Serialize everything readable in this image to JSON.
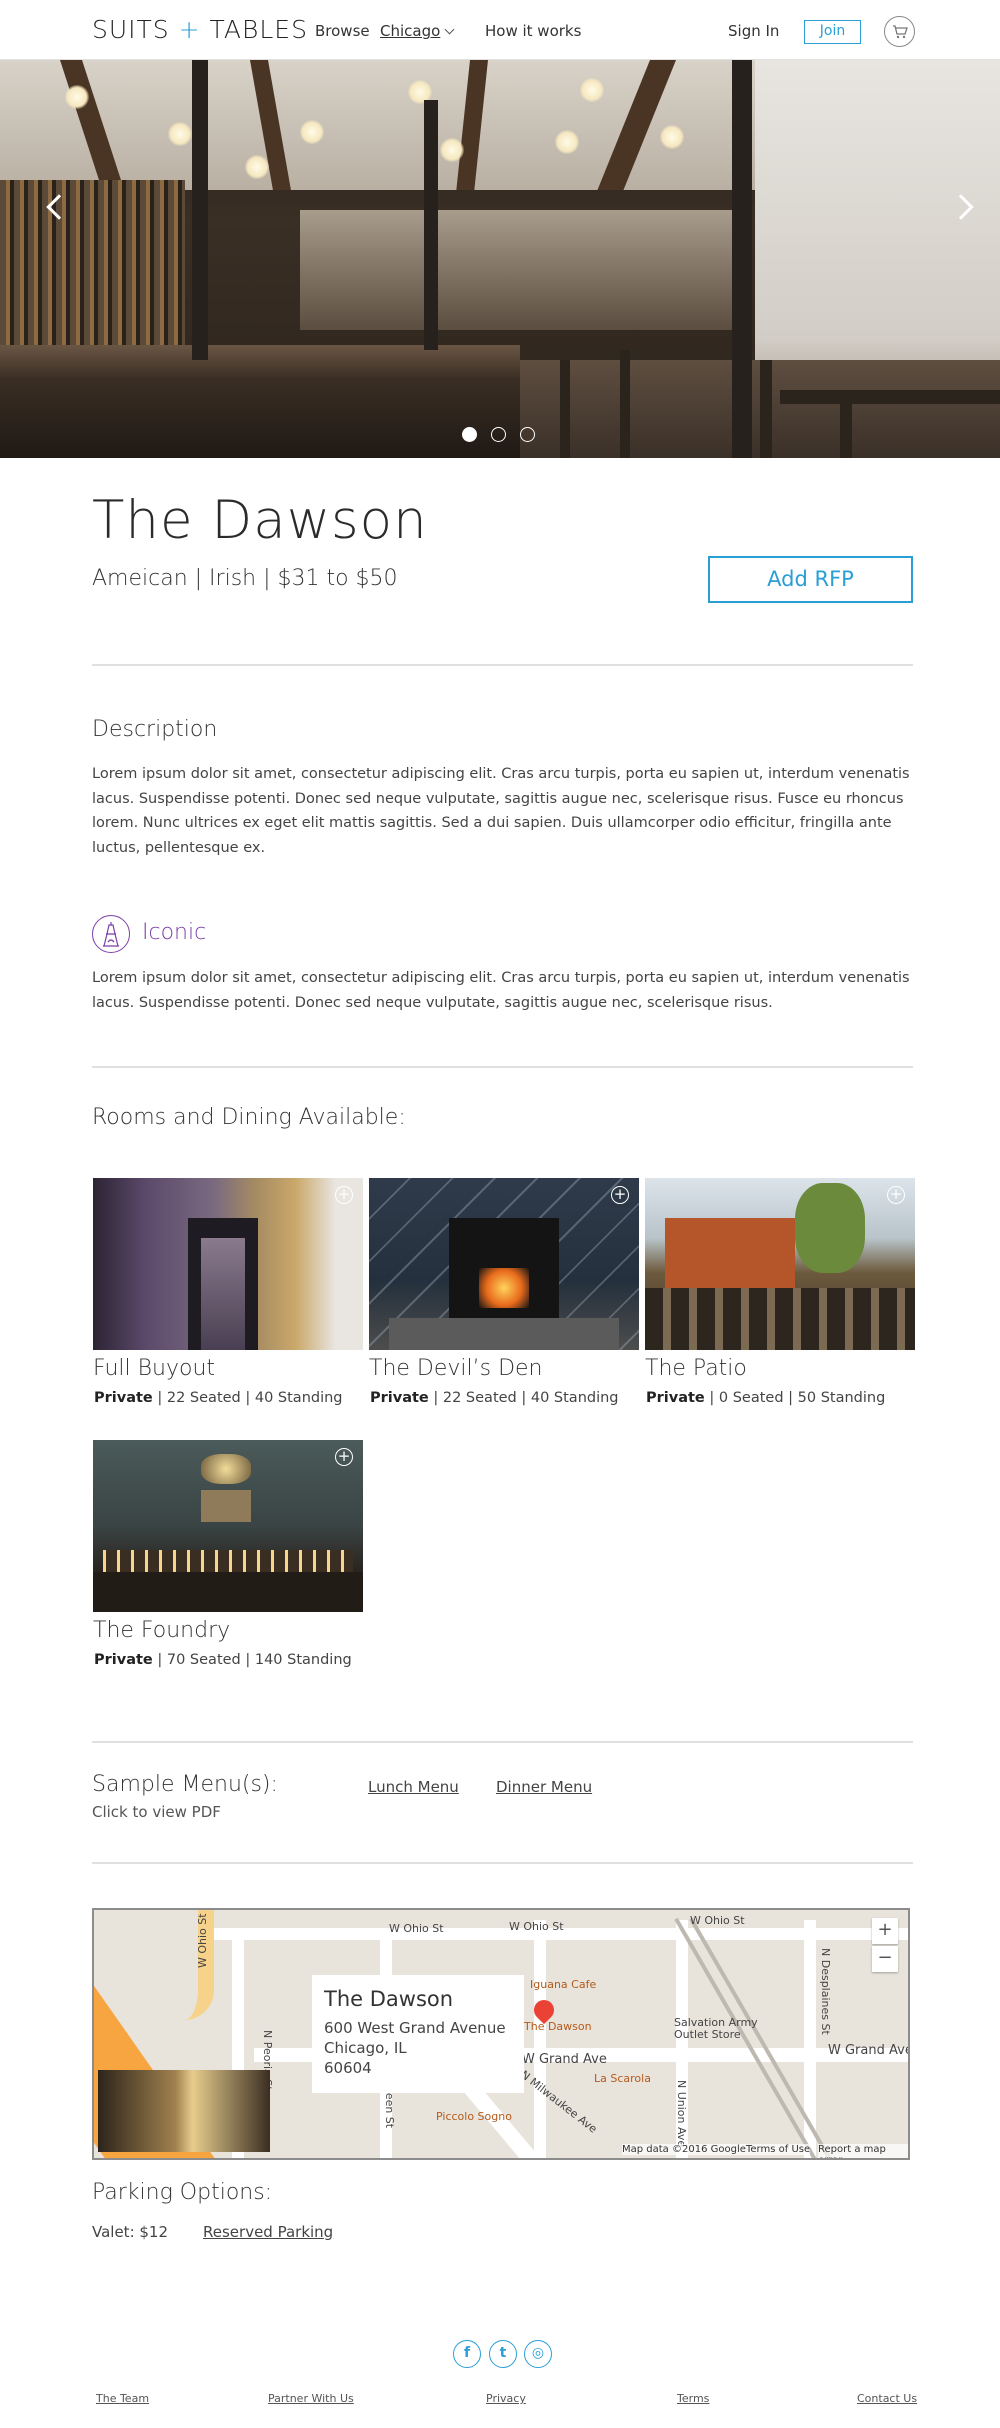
{
  "header": {
    "logo_left": "SUITS",
    "logo_plus": "+",
    "logo_right": "TABLES",
    "browse": "Browse",
    "city": "Chicago",
    "how_it_works": "How it works",
    "sign_in": "Sign In",
    "join": "Join"
  },
  "venue": {
    "name": "The Dawson",
    "subtitle": "Ameican | Irish | $31 to $50",
    "add_rfp": "Add RFP"
  },
  "description": {
    "heading": "Description",
    "text": "Lorem ipsum dolor sit amet, consectetur adipiscing elit. Cras arcu turpis, porta eu sapien ut, interdum venenatis lacus. Suspendisse potenti. Donec sed neque vulputate, sagittis augue nec, scelerisque risus. Fusce eu rhoncus lorem. Nunc ultrices ex eget elit mattis sagittis. Sed a dui sapien. Duis ullamcorper odio efficitur, fringilla ante luctus, pellentesque ex."
  },
  "iconic": {
    "label": "Iconic",
    "text": "Lorem ipsum dolor sit amet, consectetur adipiscing elit. Cras arcu turpis, porta eu sapien ut, interdum venenatis lacus. Suspendisse potenti. Donec sed neque vulputate, sagittis augue nec, scelerisque risus."
  },
  "rooms": {
    "heading": "Rooms and Dining Available:",
    "items": [
      {
        "name": "Full Buyout",
        "type": "Private",
        "details": " | 22 Seated | 40 Standing"
      },
      {
        "name": "The Devil’s Den",
        "type": "Private",
        "details": " | 22 Seated | 40 Standing"
      },
      {
        "name": "The Patio",
        "type": "Private",
        "details": " | 0 Seated | 50 Standing"
      },
      {
        "name": "The Foundry",
        "type": "Private",
        "details": " | 70 Seated | 140 Standing"
      }
    ]
  },
  "menus": {
    "heading": "Sample Menu(s):",
    "sub": "Click to view PDF",
    "lunch": "Lunch Menu",
    "dinner": "Dinner Menu"
  },
  "map": {
    "card_title": "The Dawson",
    "line1": "600 West Grand Avenue",
    "line2": "Chicago, IL",
    "line3": "60604",
    "zoom_in": "+",
    "zoom_out": "−",
    "streets": {
      "w_ohio_1": "W Ohio St",
      "w_ohio_2": "W Ohio St",
      "w_ohio_3": "W Ohio St",
      "w_ohio_left": "W Ohio St",
      "n_peoria": "N Peoria St",
      "n_desplaines": "N Desplaines St",
      "w_grand": "W Grand Ave",
      "w_grand_right": "W Grand Ave",
      "milwaukee": "N Milwaukee Ave",
      "n_union": "N Union Ave",
      "green": "Green St"
    },
    "pois": {
      "iguana": "Iguana Cafe",
      "dawson": "The Dawson",
      "salvation": "Salvation Army",
      "salvation2": "Outlet Store",
      "la_scarola": "La Scarola",
      "piccolo": "Piccolo Sogno"
    },
    "attrib_data": "Map data ©2016 Google",
    "attrib_terms": "Terms of Use",
    "attrib_report": "Report a map error"
  },
  "parking": {
    "heading": "Parking Options:",
    "valet": "Valet: $12",
    "reserved": "Reserved Parking"
  },
  "social": {
    "facebook": "f",
    "twitter": "t",
    "instagram": "◎"
  },
  "footer": {
    "team": "The Team",
    "partner": "Partner With Us",
    "privacy": "Privacy",
    "terms": "Terms",
    "contact": "Contact Us"
  },
  "colors": {
    "accent": "#2a9fd6",
    "iconic": "#7b3fa8",
    "divider": "#e0e0e0"
  }
}
